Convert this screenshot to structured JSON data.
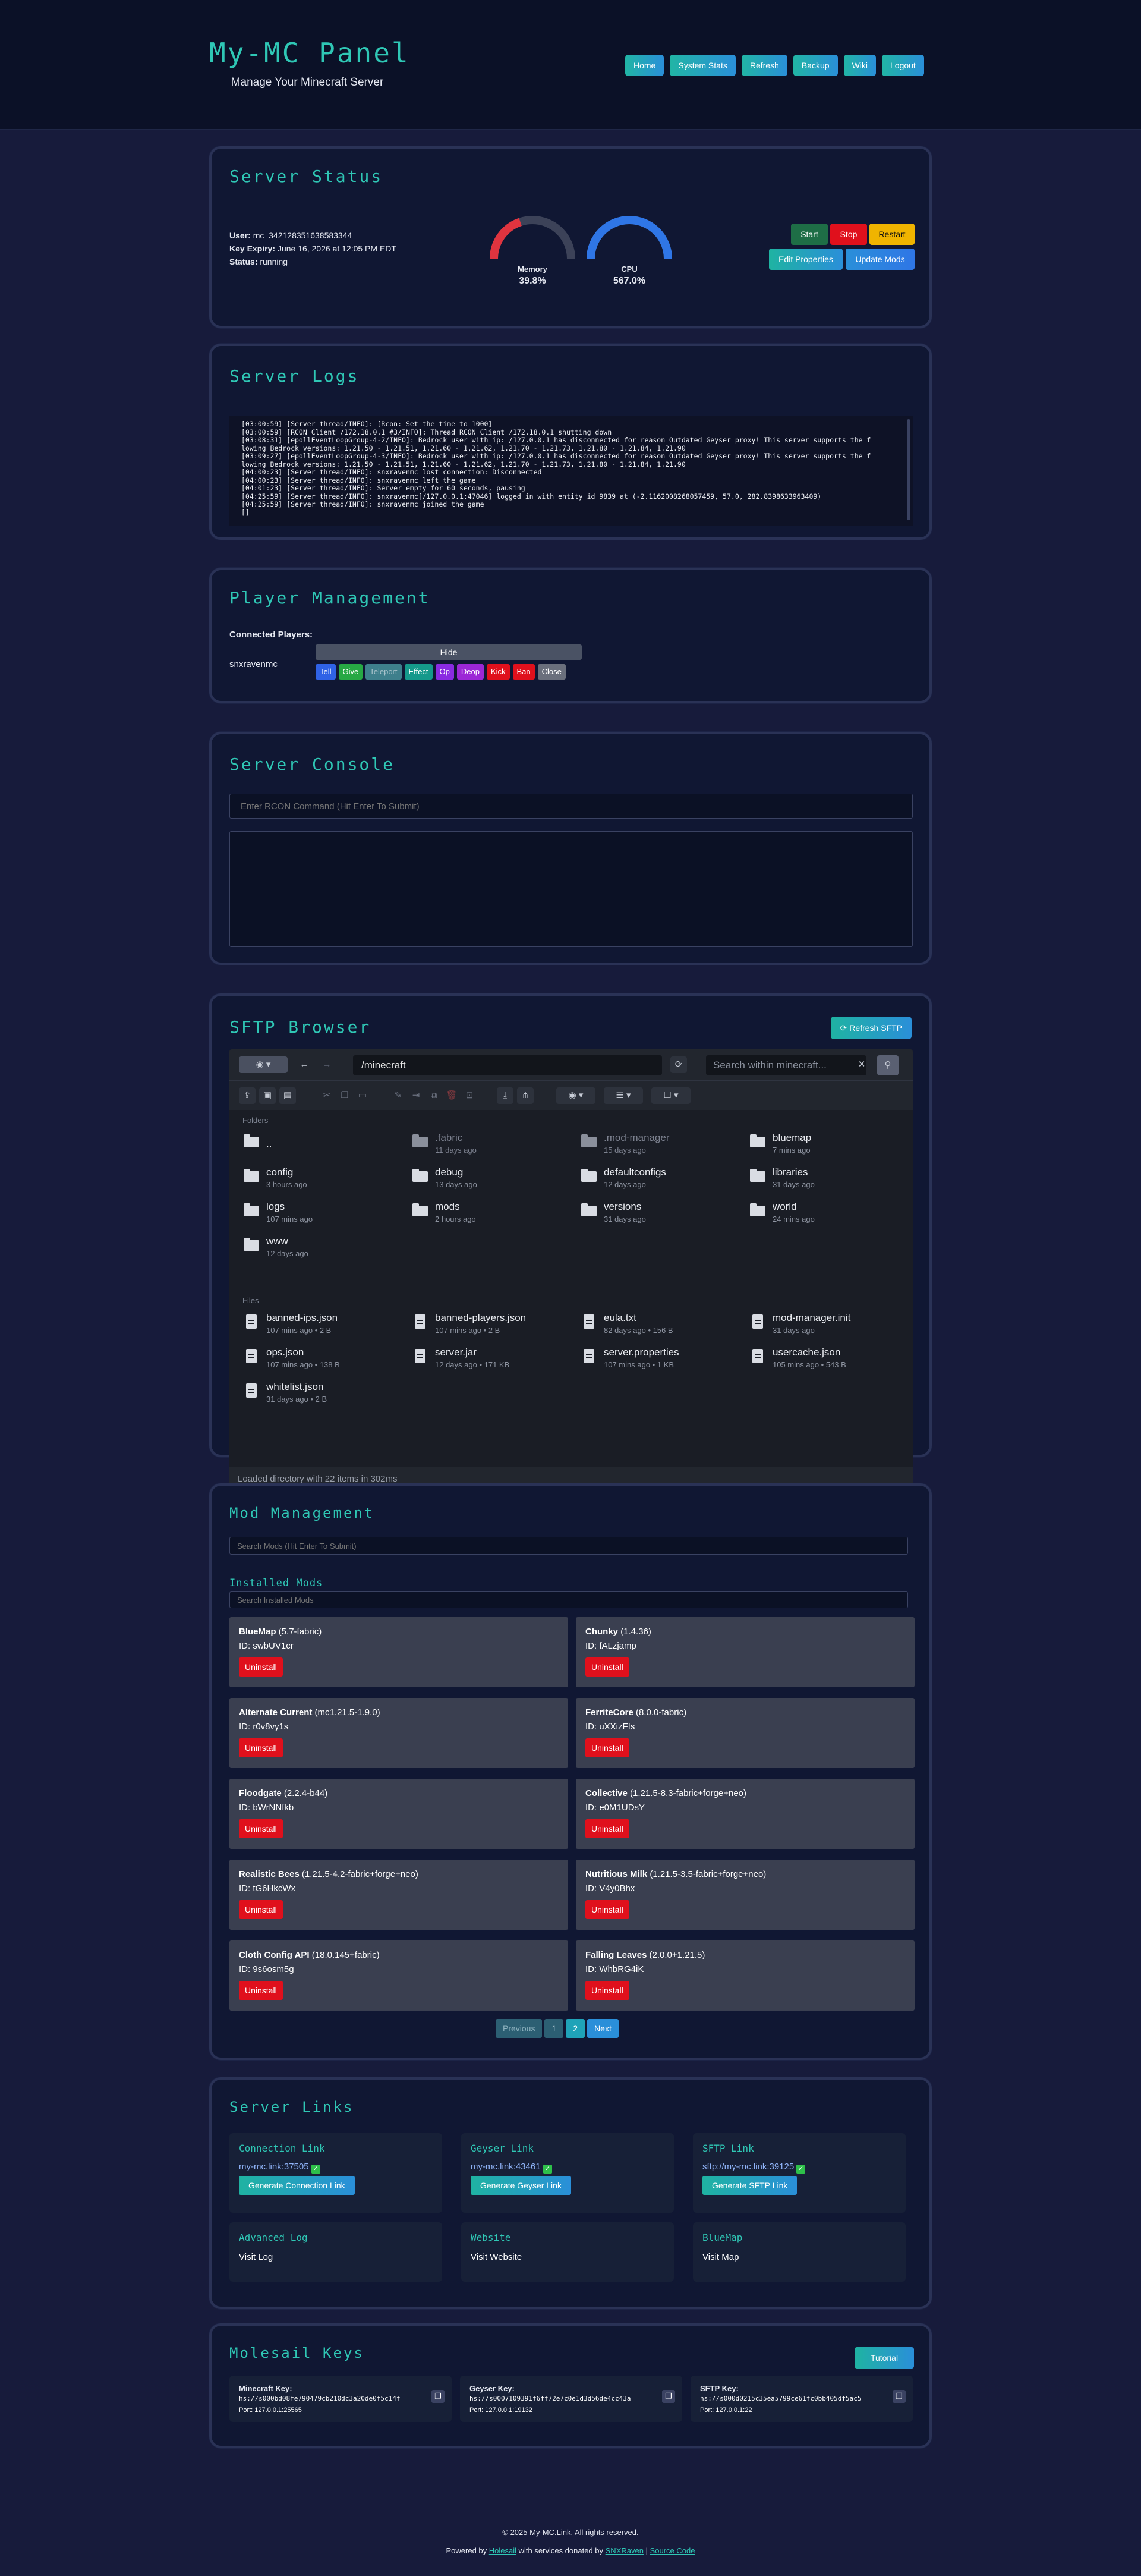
{
  "header": {
    "title": "My-MC Panel",
    "subtitle": "Manage Your Minecraft Server",
    "nav": [
      "Home",
      "System Stats",
      "Refresh",
      "Backup",
      "Wiki",
      "Logout"
    ]
  },
  "status": {
    "title": "Server Status",
    "user_label": "User:",
    "user": "mc_342128351638583344",
    "expiry_label": "Key Expiry:",
    "expiry": "June 16, 2026 at 12:05 PM EDT",
    "status_label": "Status:",
    "status": "running",
    "memory_label": "Memory",
    "memory_value": "39.8%",
    "memory_fraction": 0.398,
    "cpu_label": "CPU",
    "cpu_value": "567.0%",
    "cpu_fraction": 1.0,
    "buttons": {
      "start": "Start",
      "stop": "Stop",
      "restart": "Restart",
      "edit": "Edit Properties",
      "update": "Update Mods"
    }
  },
  "logs": {
    "title": "Server Logs",
    "lines": [
      "[03:00:59] [Server thread/INFO]: [Rcon: Set the time to 1000]",
      "[03:00:59] [RCON Client /172.18.0.1 #3/INFO]: Thread RCON Client /172.18.0.1 shutting down",
      "[03:08:31] [epollEventLoopGroup-4-2/INFO]: Bedrock user with ip: /127.0.0.1 has disconnected for reason Outdated Geyser proxy! This server supports the f",
      "lowing Bedrock versions: 1.21.50 - 1.21.51, 1.21.60 - 1.21.62, 1.21.70 - 1.21.73, 1.21.80 - 1.21.84, 1.21.90",
      "[03:09:27] [epollEventLoopGroup-4-3/INFO]: Bedrock user with ip: /127.0.0.1 has disconnected for reason Outdated Geyser proxy! This server supports the f",
      "lowing Bedrock versions: 1.21.50 - 1.21.51, 1.21.60 - 1.21.62, 1.21.70 - 1.21.73, 1.21.80 - 1.21.84, 1.21.90",
      "[04:00:23] [Server thread/INFO]: snxravenmc lost connection: Disconnected",
      "[04:00:23] [Server thread/INFO]: snxravenmc left the game",
      "[04:01:23] [Server thread/INFO]: Server empty for 60 seconds, pausing",
      "[04:25:59] [Server thread/INFO]: snxravenmc[/127.0.0.1:47046] logged in with entity id 9839 at (-2.1162008268057459, 57.0, 282.8398633963409)",
      "[04:25:59] [Server thread/INFO]: snxravenmc joined the game",
      "[]"
    ]
  },
  "players": {
    "title": "Player Management",
    "connected_label": "Connected Players:",
    "hide_label": "Hide",
    "list": [
      {
        "name": "snxravenmc"
      }
    ],
    "actions": [
      "Tell",
      "Give",
      "Teleport",
      "Effect",
      "Op",
      "Deop",
      "Kick",
      "Ban",
      "Close"
    ]
  },
  "console": {
    "title": "Server Console",
    "placeholder": "Enter RCON Command (Hit Enter To Submit)"
  },
  "sftp": {
    "title": "SFTP Browser",
    "refresh_label": "Refresh SFTP",
    "path": "/minecraft",
    "search_placeholder": "Search within minecraft...",
    "folders_label": "Folders",
    "files_label": "Files",
    "folders": [
      {
        "name": "..",
        "meta": "",
        "dim": false,
        "up": true
      },
      {
        "name": ".fabric",
        "meta": "11 days ago",
        "dim": true
      },
      {
        "name": ".mod-manager",
        "meta": "15 days ago",
        "dim": true
      },
      {
        "name": "bluemap",
        "meta": "7 mins ago",
        "dim": false
      },
      {
        "name": "config",
        "meta": "3 hours ago",
        "dim": false
      },
      {
        "name": "debug",
        "meta": "13 days ago",
        "dim": false
      },
      {
        "name": "defaultconfigs",
        "meta": "12 days ago",
        "dim": false
      },
      {
        "name": "libraries",
        "meta": "31 days ago",
        "dim": false
      },
      {
        "name": "logs",
        "meta": "107 mins ago",
        "dim": false
      },
      {
        "name": "mods",
        "meta": "2 hours ago",
        "dim": false
      },
      {
        "name": "versions",
        "meta": "31 days ago",
        "dim": false
      },
      {
        "name": "world",
        "meta": "24 mins ago",
        "dim": false
      },
      {
        "name": "www",
        "meta": "12 days ago",
        "dim": false
      }
    ],
    "files": [
      {
        "name": "banned-ips.json",
        "meta": "107 mins ago • 2 B"
      },
      {
        "name": "banned-players.json",
        "meta": "107 mins ago • 2 B"
      },
      {
        "name": "eula.txt",
        "meta": "82 days ago • 156 B"
      },
      {
        "name": "mod-manager.init",
        "meta": "31 days ago"
      },
      {
        "name": "ops.json",
        "meta": "107 mins ago • 138 B"
      },
      {
        "name": "server.jar",
        "meta": "12 days ago • 171 KB"
      },
      {
        "name": "server.properties",
        "meta": "107 mins ago • 1 KB"
      },
      {
        "name": "usercache.json",
        "meta": "105 mins ago • 543 B"
      },
      {
        "name": "whitelist.json",
        "meta": "31 days ago • 2 B"
      }
    ],
    "status_text": "Loaded directory with 22 items in 302ms"
  },
  "mods": {
    "title": "Mod Management",
    "search_placeholder": "Search Mods (Hit Enter To Submit)",
    "installed_label": "Installed Mods",
    "installed_placeholder": "Search Installed Mods",
    "uninstall_label": "Uninstall",
    "list": [
      {
        "name": "BlueMap",
        "version": "(5.7-fabric)",
        "id": "ID: swbUV1cr"
      },
      {
        "name": "Chunky",
        "version": "(1.4.36)",
        "id": "ID: fALzjamp"
      },
      {
        "name": "Alternate Current",
        "version": "(mc1.21.5-1.9.0)",
        "id": "ID: r0v8vy1s"
      },
      {
        "name": "FerriteCore",
        "version": "(8.0.0-fabric)",
        "id": "ID: uXXizFIs"
      },
      {
        "name": "Floodgate",
        "version": "(2.2.4-b44)",
        "id": "ID: bWrNNfkb"
      },
      {
        "name": "Collective",
        "version": "(1.21.5-8.3-fabric+forge+neo)",
        "id": "ID: e0M1UDsY"
      },
      {
        "name": "Realistic Bees",
        "version": "(1.21.5-4.2-fabric+forge+neo)",
        "id": "ID: tG6HkcWx"
      },
      {
        "name": "Nutritious Milk",
        "version": "(1.21.5-3.5-fabric+forge+neo)",
        "id": "ID: V4y0Bhx"
      },
      {
        "name": "Cloth Config API",
        "version": "(18.0.145+fabric)",
        "id": "ID: 9s6osm5g"
      },
      {
        "name": "Falling Leaves",
        "version": "(2.0.0+1.21.5)",
        "id": "ID: WhbRG4iK"
      }
    ],
    "pagination": {
      "previous": "Previous",
      "pages": [
        "1",
        "2"
      ],
      "next": "Next"
    }
  },
  "links": {
    "title": "Server Links",
    "generated": [
      {
        "title": "Connection Link",
        "url": "my-mc.link:37505",
        "button": "Generate Connection Link"
      },
      {
        "title": "Geyser Link",
        "url": "my-mc.link:43461",
        "button": "Generate Geyser Link"
      },
      {
        "title": "SFTP Link",
        "url": "sftp://my-mc.link:39125",
        "button": "Generate SFTP Link"
      }
    ],
    "simple": [
      {
        "title": "Advanced Log",
        "text": "Visit Log"
      },
      {
        "title": "Website",
        "text": "Visit Website"
      },
      {
        "title": "BlueMap",
        "text": "Visit Map"
      }
    ]
  },
  "keys": {
    "title": "Molesail Keys",
    "tutorial_label": "Tutorial",
    "list": [
      {
        "label": "Minecraft Key:",
        "value": "hs://s000bd08fe790479cb210dc3a20de0f5c14f",
        "port": "Port: 127.0.0.1:25565"
      },
      {
        "label": "Geyser Key:",
        "value": "hs://s0007109391f6ff72e7c0e1d3d56de4cc43a",
        "port": "Port: 127.0.0.1:19132"
      },
      {
        "label": "SFTP Key:",
        "value": "hs://s000d0215c35ea5799ce61fc0bb405df5ac5",
        "port": "Port: 127.0.0.1:22"
      }
    ]
  },
  "footer": {
    "copyright": "© 2025 My-MC.Link. All rights reserved.",
    "powered_prefix": "Powered by",
    "holesail": "Holesail",
    "donated_text": "with services donated by",
    "snxraven": "SNXRaven",
    "separator": "|",
    "source": "Source Code"
  },
  "colors": {
    "accent": "#2fc7b5",
    "background": "#171b3b",
    "card": "#101733",
    "start": "#1e6e46",
    "stop": "#e0101c",
    "restart": "#f0b400"
  }
}
